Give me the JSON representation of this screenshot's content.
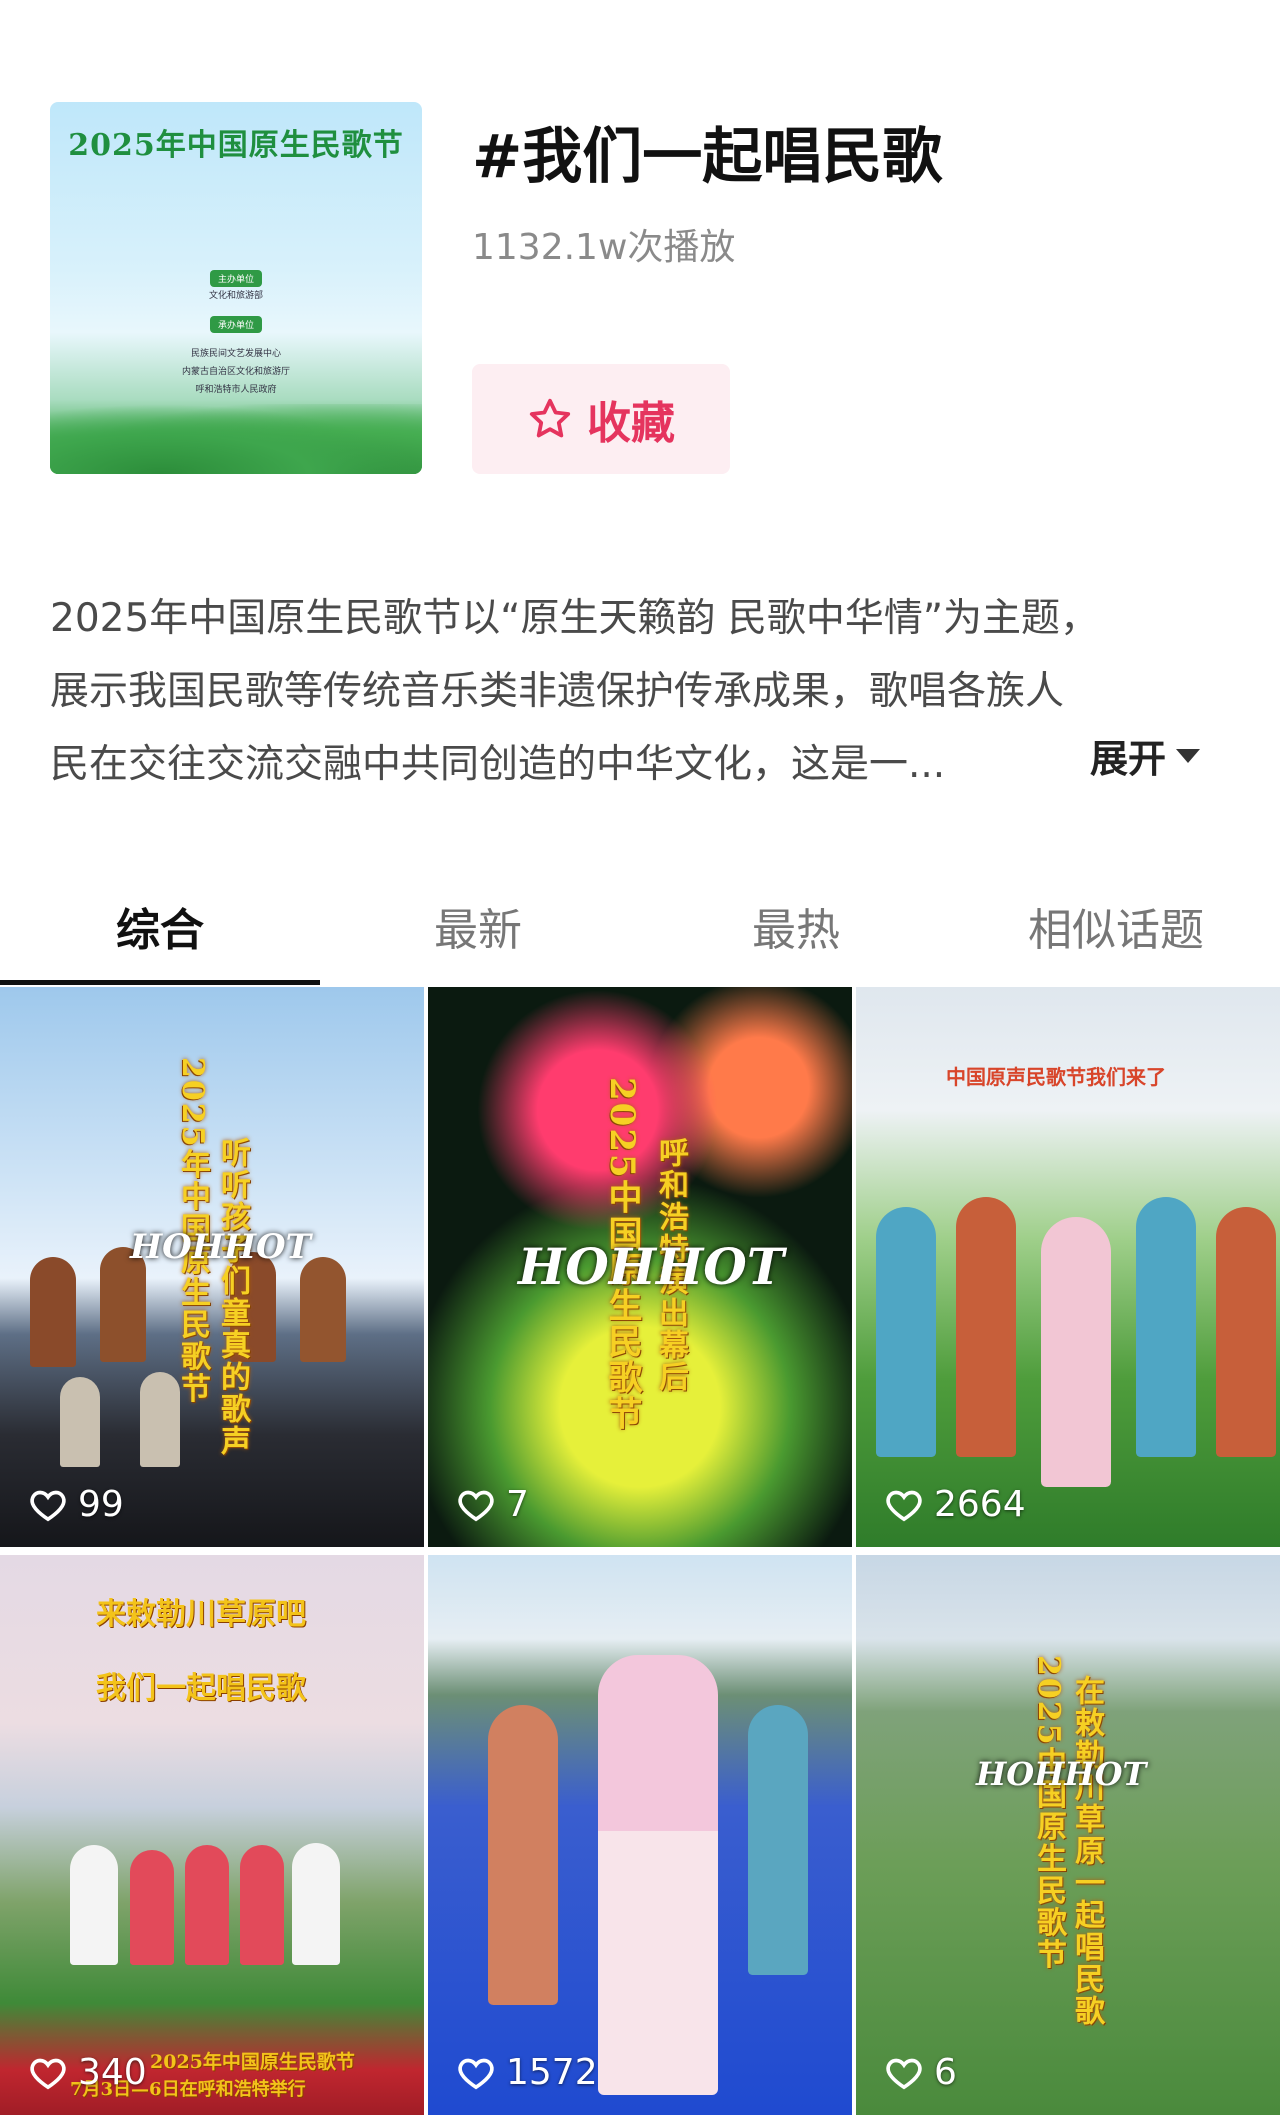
{
  "cover": {
    "title": "2025年中国原生民歌节",
    "badge1": "主办单位",
    "line1": "文化和旅游部",
    "badge2": "承办单位",
    "line2": "民族民间文艺发展中心",
    "line3": "内蒙古自治区文化和旅游厅",
    "line4": "呼和浩特市人民政府"
  },
  "topic": {
    "title": "#我们一起唱民歌",
    "plays": "1132.1w次播放",
    "favorite_label": "收藏"
  },
  "description": {
    "lines": [
      "2025年中国原生民歌节以“原生天籁韵 民歌中华情”为主题，",
      "展示我国民歌等传统音乐类非遗保护传承成果，歌唱各族人",
      "民在交往交流交融中共同创造的中华文化，这是一..."
    ],
    "expand_label": "展开"
  },
  "tabs": [
    "综合",
    "最新",
    "最热",
    "相似话题"
  ],
  "videos": [
    {
      "likes": "99",
      "vtext1": "2025年中国原生民歌节",
      "vtext2": "听听孩子们童真的歌声",
      "brand": "HOHHOT"
    },
    {
      "likes": "7",
      "vtext1": "2025中国原生民歌节",
      "vtext2": "呼和浩特演出幕后",
      "brand": "HOHHOT"
    },
    {
      "likes": "2664",
      "caption": "中国原声民歌节我们来了"
    },
    {
      "likes": "340",
      "caption1": "来敕勒川草原吧",
      "caption2": "我们一起唱民歌",
      "footer1": "2025年中国原生民歌节",
      "footer2": "7月3日—6日在呼和浩特举行"
    },
    {
      "likes": "1572"
    },
    {
      "likes": "6",
      "vtext1": "2025中国原生民歌节",
      "vtext2": "在敕勒川草原一起唱民歌",
      "brand": "HOHHOT"
    }
  ],
  "colors": {
    "accent": "#e5345e",
    "fav_bg": "#fdeef2"
  }
}
